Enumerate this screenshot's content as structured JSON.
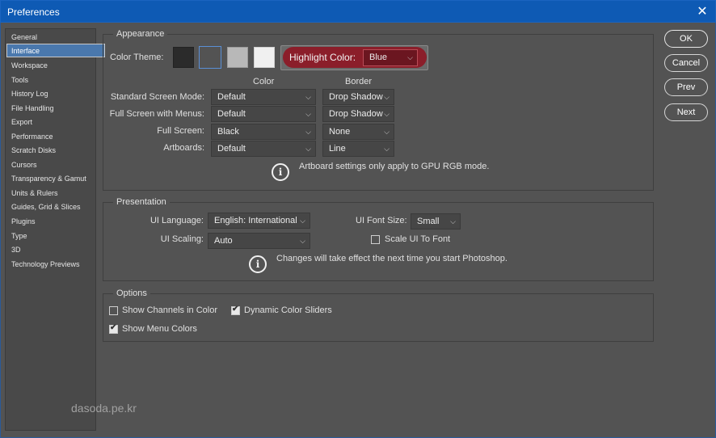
{
  "window": {
    "title": "Preferences",
    "close_glyph": "✕"
  },
  "sidebar": {
    "items": [
      "General",
      "Interface",
      "Workspace",
      "Tools",
      "History Log",
      "File Handling",
      "Export",
      "Performance",
      "Scratch Disks",
      "Cursors",
      "Transparency & Gamut",
      "Units & Rulers",
      "Guides, Grid & Slices",
      "Plugins",
      "Type",
      "3D",
      "Technology Previews"
    ],
    "active": "Interface"
  },
  "appearance": {
    "title": "Appearance",
    "color_theme_label": "Color Theme:",
    "theme_swatch_colors": [
      "#2b2b2b",
      "#535353",
      "#b8b8b8",
      "#f0f0f0"
    ],
    "highlight_label": "Highlight Color:",
    "highlight_value": "Blue",
    "col_color": "Color",
    "col_border": "Border",
    "rows": [
      {
        "label": "Standard Screen Mode:",
        "color": "Default",
        "border": "Drop Shadow"
      },
      {
        "label": "Full Screen with Menus:",
        "color": "Default",
        "border": "Drop Shadow"
      },
      {
        "label": "Full Screen:",
        "color": "Black",
        "border": "None"
      },
      {
        "label": "Artboards:",
        "color": "Default",
        "border": "Line"
      }
    ],
    "info": "Artboard settings only apply to GPU RGB mode."
  },
  "presentation": {
    "title": "Presentation",
    "ui_language_label": "UI Language:",
    "ui_language_value": "English: International",
    "ui_font_size_label": "UI Font Size:",
    "ui_font_size_value": "Small",
    "ui_scaling_label": "UI Scaling:",
    "ui_scaling_value": "Auto",
    "scale_ui_label": "Scale UI To Font",
    "scale_ui_checked": false,
    "info": "Changes will take effect the next time you start Photoshop."
  },
  "options": {
    "title": "Options",
    "show_channels_label": "Show Channels in Color",
    "show_channels_checked": false,
    "dynamic_sliders_label": "Dynamic Color Sliders",
    "dynamic_sliders_checked": true,
    "show_menu_colors_label": "Show Menu Colors",
    "show_menu_colors_checked": true
  },
  "buttons": {
    "ok": "OK",
    "cancel": "Cancel",
    "prev": "Prev",
    "next": "Next"
  },
  "watermark": "dasoda.pe.kr",
  "colors": {
    "titlebar": "#0e5ab4",
    "active_item": "#4a78ad",
    "highlight_pill": "#8b1e2a",
    "dialog_bg": "#535353"
  }
}
